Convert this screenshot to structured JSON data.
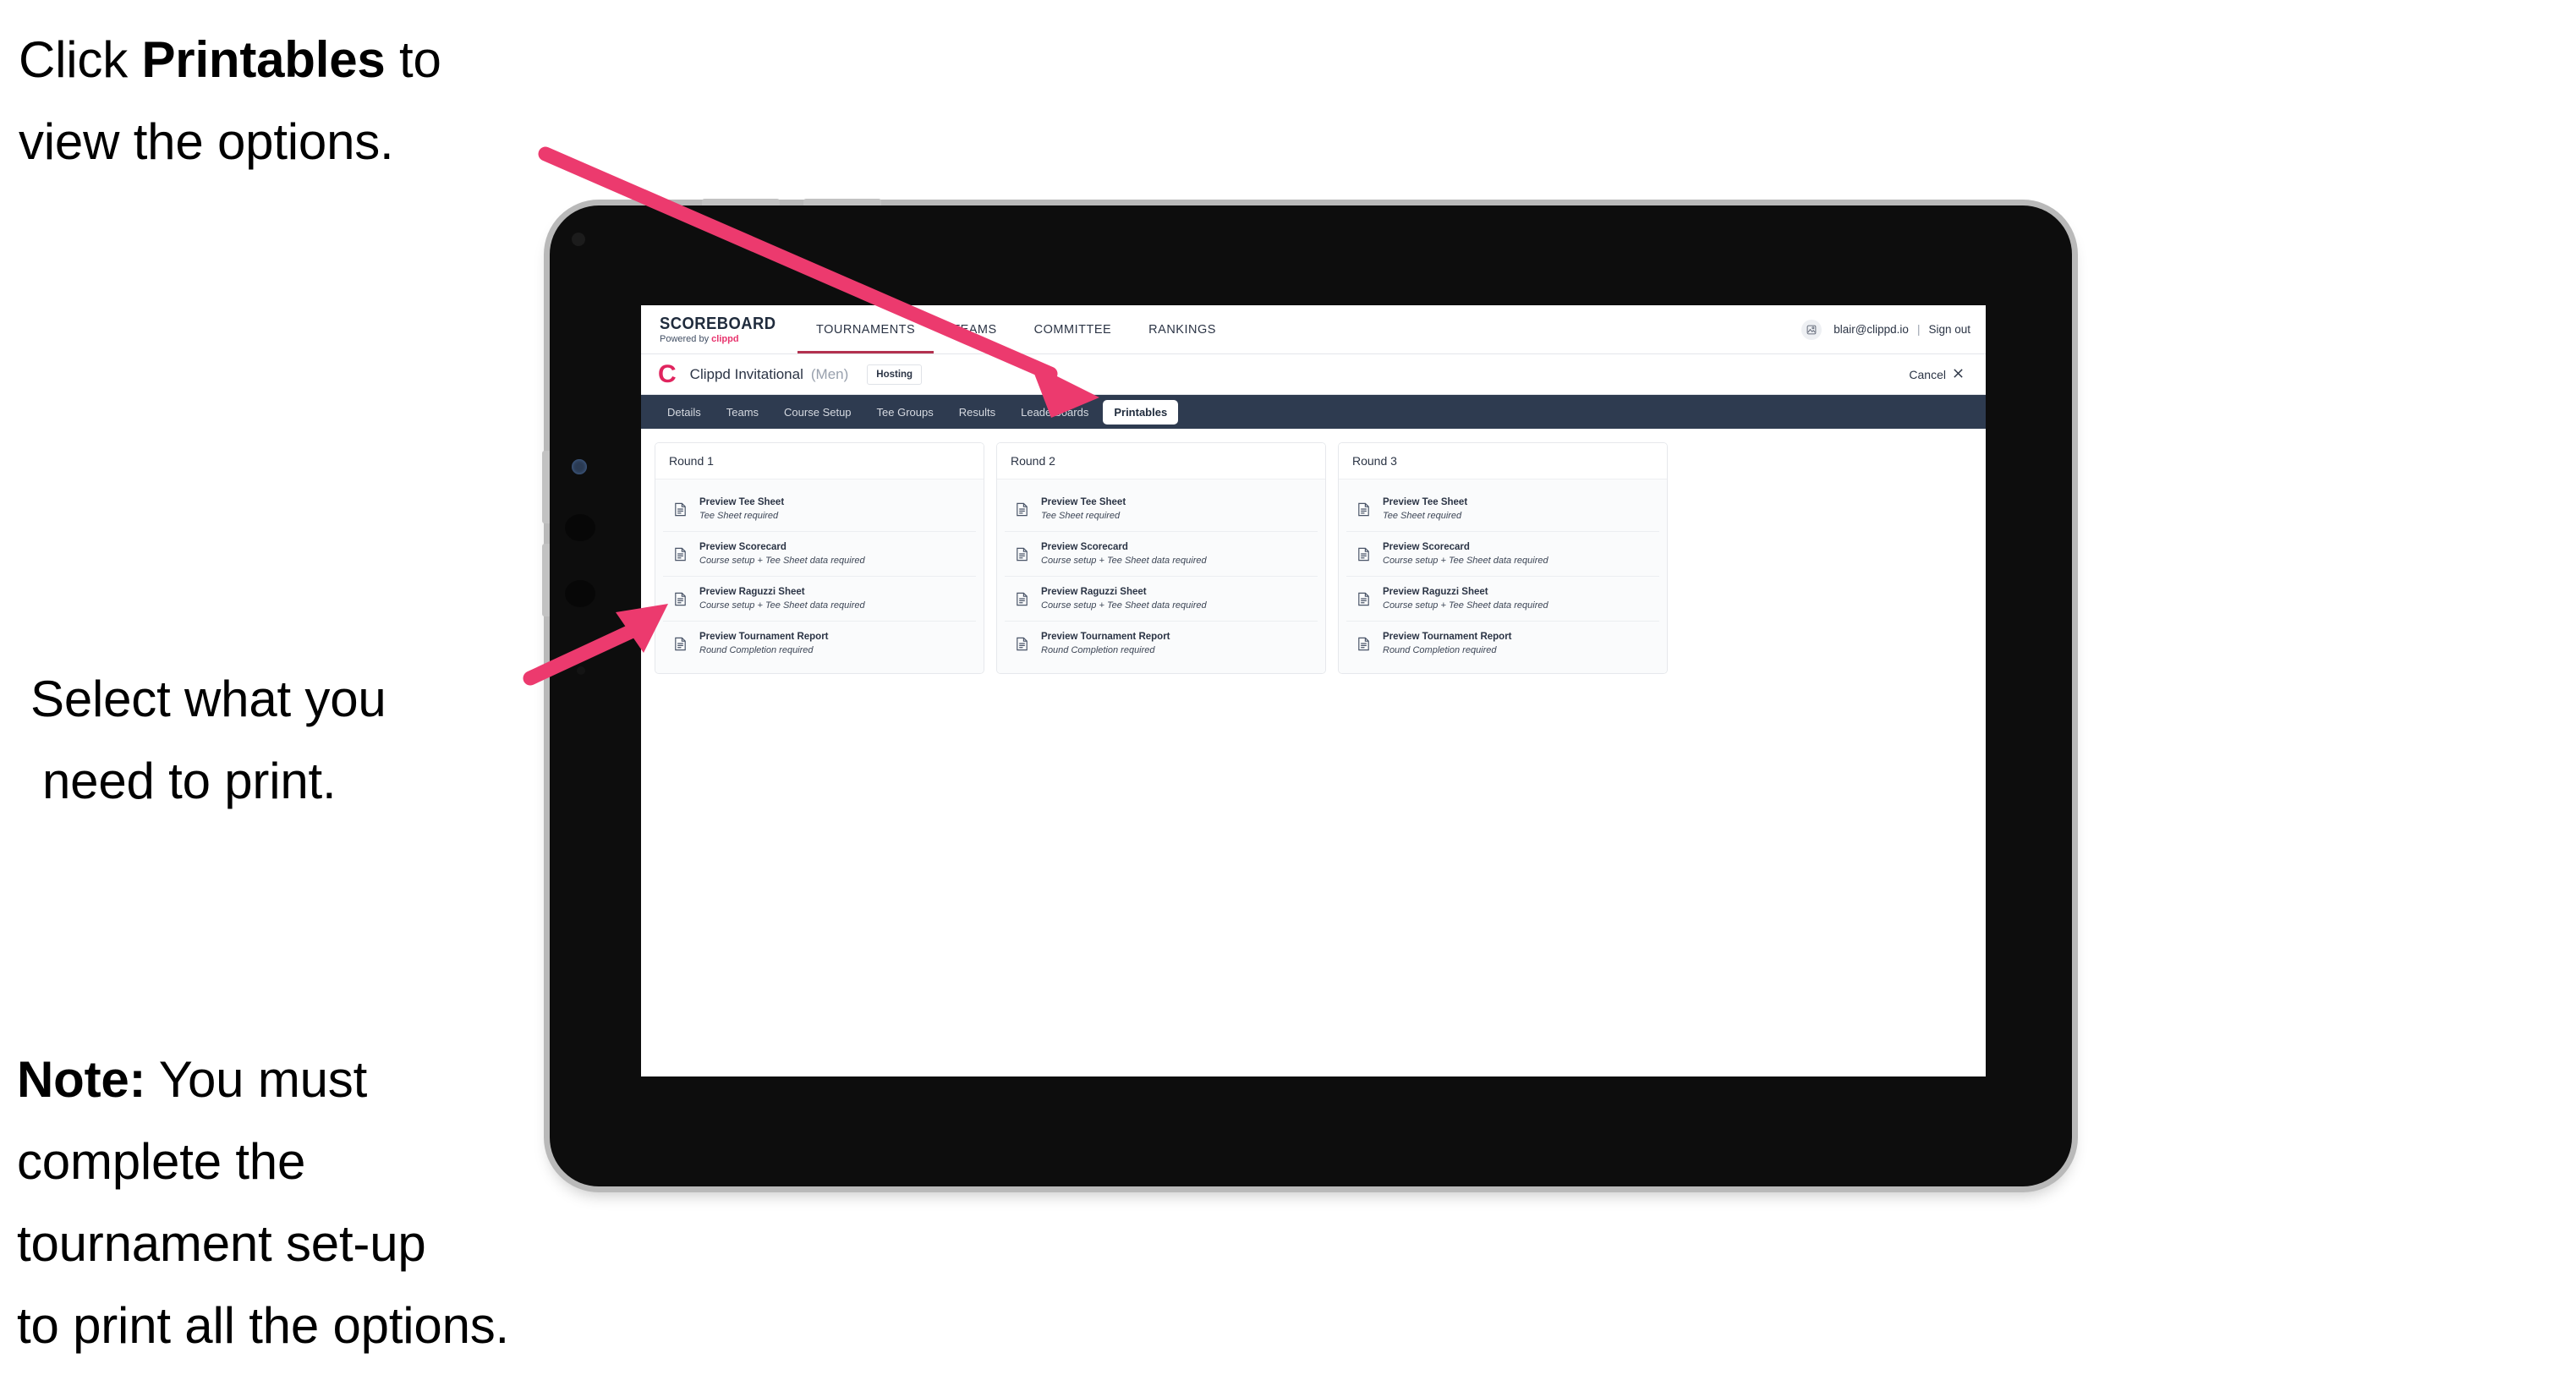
{
  "annotations": {
    "click_line1_pre": "Click ",
    "click_bold": "Printables",
    "click_line1_post": " to",
    "click_line2": "view the options.",
    "select_line1": "Select what you",
    "select_line2": "need to print.",
    "note_bold": "Note:",
    "note_line1_rest": " You must",
    "note_line2": "complete the",
    "note_line3": "tournament set-up",
    "note_line4": "to print all the options."
  },
  "colors": {
    "arrow_pink": "#ec3a6e",
    "brand_pink": "#e0245e",
    "tabstrip_navy": "#2e3b50",
    "logo_navy": "#1f2b3c",
    "nav_underline": "#b3324f"
  },
  "app": {
    "logo": {
      "wordmark": "SCOREBOARD",
      "powered_by": "Powered by ",
      "powered_brand": "clippd"
    },
    "nav_tabs": [
      {
        "label": "TOURNAMENTS",
        "active": true
      },
      {
        "label": "TEAMS",
        "active": false
      },
      {
        "label": "COMMITTEE",
        "active": false
      },
      {
        "label": "RANKINGS",
        "active": false
      }
    ],
    "account": {
      "avatar_icon": "user-avatar-icon",
      "email": "blair@clippd.io",
      "separator": "|",
      "sign_out": "Sign out"
    },
    "tournament": {
      "logo_letter": "C",
      "name": "Clippd Invitational",
      "gender": "(Men)",
      "badge": "Hosting",
      "cancel_label": "Cancel",
      "cancel_icon": "close-icon"
    },
    "section_tabs": [
      {
        "label": "Details",
        "active": false
      },
      {
        "label": "Teams",
        "active": false
      },
      {
        "label": "Course Setup",
        "active": false
      },
      {
        "label": "Tee Groups",
        "active": false
      },
      {
        "label": "Results",
        "active": false
      },
      {
        "label": "Leaderboards",
        "active": false
      },
      {
        "label": "Printables",
        "active": true
      }
    ],
    "rounds": [
      {
        "title": "Round 1",
        "items": [
          {
            "title": "Preview Tee Sheet",
            "sub": "Tee Sheet required",
            "icon": "document-icon"
          },
          {
            "title": "Preview Scorecard",
            "sub": "Course setup + Tee Sheet data required",
            "icon": "document-icon"
          },
          {
            "title": "Preview Raguzzi Sheet",
            "sub": "Course setup + Tee Sheet data required",
            "icon": "document-icon"
          },
          {
            "title": "Preview Tournament Report",
            "sub": "Round Completion required",
            "icon": "document-icon"
          }
        ]
      },
      {
        "title": "Round 2",
        "items": [
          {
            "title": "Preview Tee Sheet",
            "sub": "Tee Sheet required",
            "icon": "document-icon"
          },
          {
            "title": "Preview Scorecard",
            "sub": "Course setup + Tee Sheet data required",
            "icon": "document-icon"
          },
          {
            "title": "Preview Raguzzi Sheet",
            "sub": "Course setup + Tee Sheet data required",
            "icon": "document-icon"
          },
          {
            "title": "Preview Tournament Report",
            "sub": "Round Completion required",
            "icon": "document-icon"
          }
        ]
      },
      {
        "title": "Round 3",
        "items": [
          {
            "title": "Preview Tee Sheet",
            "sub": "Tee Sheet required",
            "icon": "document-icon"
          },
          {
            "title": "Preview Scorecard",
            "sub": "Course setup + Tee Sheet data required",
            "icon": "document-icon"
          },
          {
            "title": "Preview Raguzzi Sheet",
            "sub": "Course setup + Tee Sheet data required",
            "icon": "document-icon"
          },
          {
            "title": "Preview Tournament Report",
            "sub": "Round Completion required",
            "icon": "document-icon"
          }
        ]
      }
    ]
  }
}
